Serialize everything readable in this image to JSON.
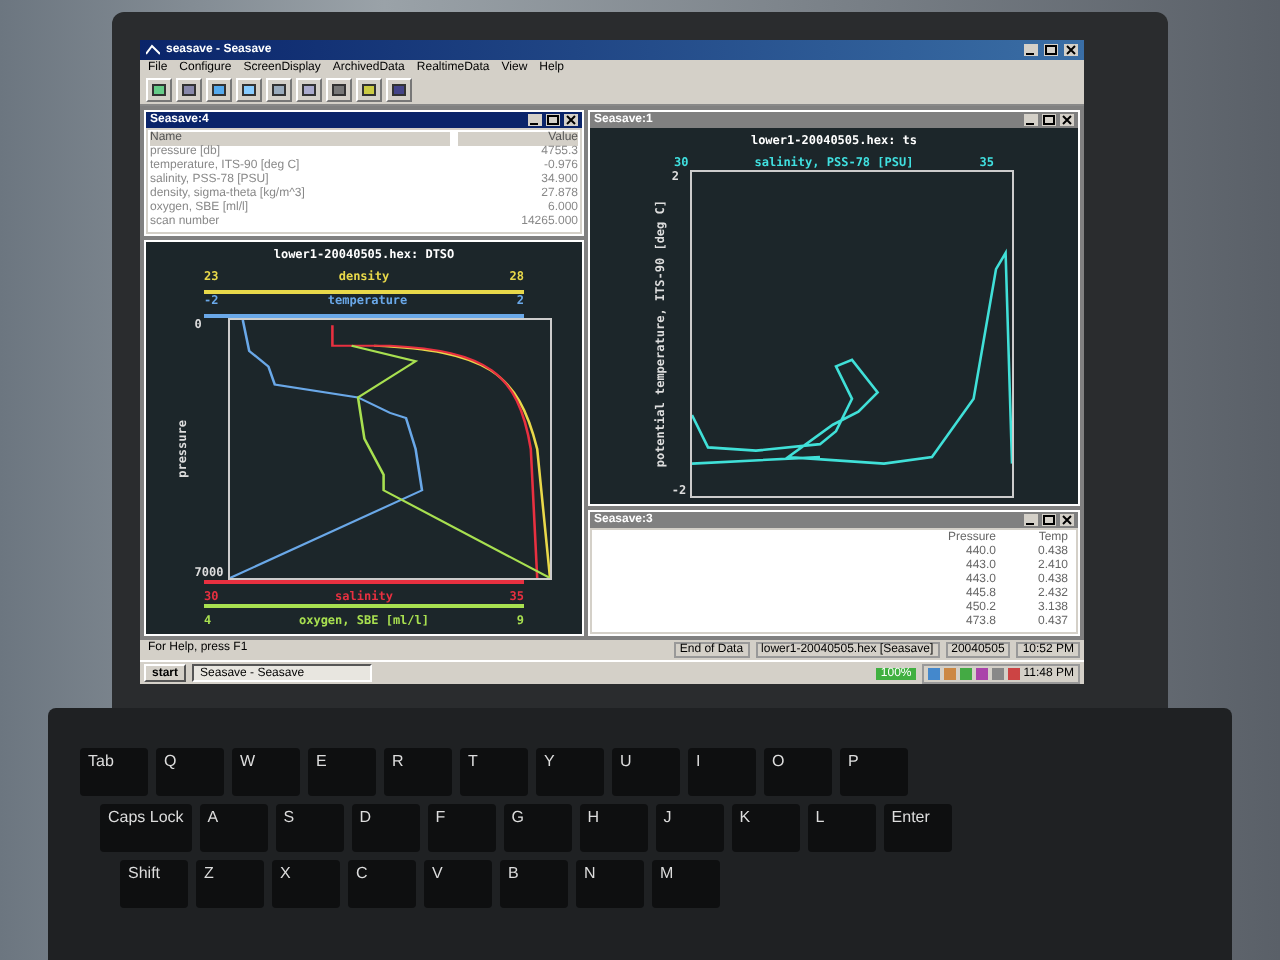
{
  "app": {
    "title": "seasave - Seasave",
    "menu": [
      "File",
      "Configure",
      "ScreenDisplay",
      "ArchivedData",
      "RealtimeData",
      "View",
      "Help"
    ]
  },
  "list_window": {
    "title": "Seasave:4",
    "columns": [
      "Name",
      "Value"
    ],
    "rows": [
      [
        "pressure [db]",
        "4755.3"
      ],
      [
        "temperature, ITS-90 [deg C]",
        "-0.976"
      ],
      [
        "salinity, PSS-78 [PSU]",
        "34.900"
      ],
      [
        "density, sigma-theta [kg/m^3]",
        "27.878"
      ],
      [
        "oxygen, SBE [ml/l]",
        "6.000"
      ],
      [
        "scan number",
        "14265.000"
      ]
    ]
  },
  "profile_plot": {
    "title": "lower1-20040505.hex: DTSO",
    "ylabel": "pressure",
    "ymin": "0",
    "ymax": "7000",
    "top_axes": [
      {
        "name": "density",
        "min": "23",
        "max": "28",
        "color": "#e8d84a"
      },
      {
        "name": "temperature",
        "min": "-2",
        "max": "2",
        "color": "#6aa8e8"
      }
    ],
    "bottom_axes": [
      {
        "name": "salinity",
        "min": "30",
        "max": "35",
        "color": "#e83040"
      },
      {
        "name": "oxygen, SBE [ml/l]",
        "min": "4",
        "max": "9",
        "color": "#a8e050"
      }
    ]
  },
  "ts_plot": {
    "window_title": "Seasave:1",
    "title": "lower1-20040505.hex: ts",
    "xlabel": "salinity, PSS-78 [PSU]",
    "xmin": "30",
    "xmax": "35",
    "ylabel": "potential temperature, ITS-90 [deg C]",
    "ymax": "2",
    "ymin": "-2"
  },
  "table_window": {
    "title": "Seasave:3",
    "columns": [
      "Pressure",
      "Temp"
    ],
    "rows": [
      [
        "440.0",
        "0.438"
      ],
      [
        "443.0",
        "2.410"
      ],
      [
        "443.0",
        "0.438"
      ],
      [
        "445.8",
        "2.432"
      ],
      [
        "450.2",
        "3.138"
      ],
      [
        "473.8",
        "0.437"
      ]
    ]
  },
  "status_bar": [
    "For Help, press F1",
    "End of Data",
    "lower1-20040505.hex [Seasave]",
    "20040505",
    "10:52 PM"
  ],
  "taskbar": {
    "start": "start",
    "tasks": [
      "Seasave - Seasave"
    ],
    "zoom": "100%",
    "clock": "11:48 PM"
  },
  "keyboard": [
    [
      "Tab",
      "Q",
      "W",
      "E",
      "R",
      "T",
      "Y",
      "U",
      "I",
      "O",
      "P"
    ],
    [
      "Caps Lock",
      "A",
      "S",
      "D",
      "F",
      "G",
      "H",
      "J",
      "K",
      "L",
      "Enter"
    ],
    [
      "Shift",
      "Z",
      "X",
      "C",
      "V",
      "B",
      "N",
      "M"
    ]
  ]
}
